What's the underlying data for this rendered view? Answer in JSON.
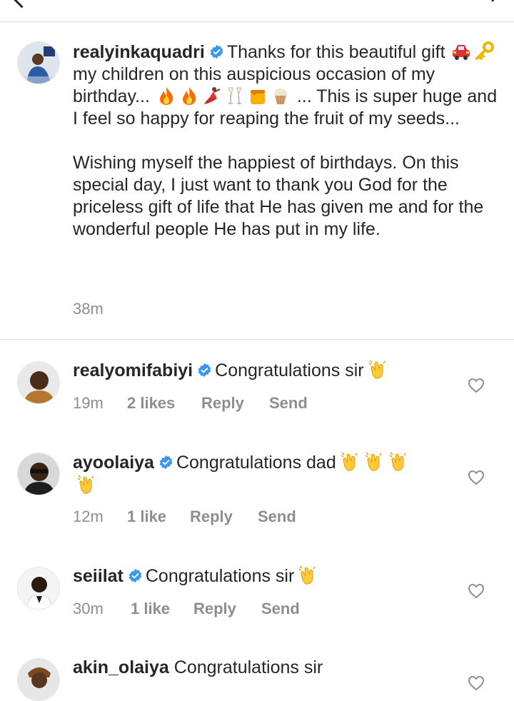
{
  "post": {
    "username": "realyinkaquadri",
    "caption_p1_a": "Thanks for this beautiful gift",
    "caption_p1_b": "my children on this auspicious occasion of my birthday...",
    "caption_p1_c": "... This is super huge and I feel so happy for reaping the fruit of my seeds...",
    "caption_p2": "Wishing myself the happiest of birthdays. On this special day, I just want to thank you God for the priceless gift of life that He has given me and for the wonderful people He has put in my life.",
    "time": "38m"
  },
  "comments": [
    {
      "username": "realyomifabiyi",
      "text": "Congratulations sir",
      "time": "19m",
      "likes": "2 likes",
      "reply": "Reply",
      "send": "Send"
    },
    {
      "username": "ayoolaiya",
      "text": "Congratulations dad",
      "time": "12m",
      "likes": "1 like",
      "reply": "Reply",
      "send": "Send"
    },
    {
      "username": "seiilat",
      "text": "Congratulations sir",
      "time": "30m",
      "likes": "1 like",
      "reply": "Reply",
      "send": "Send"
    },
    {
      "username": "akin_olaiya",
      "text": "Congratulations sir"
    }
  ],
  "icons": {
    "verified": "verified-badge-icon",
    "heart": "heart-outline-icon",
    "clap": "clapping-hands-emoji",
    "car": "car-emoji",
    "key": "key-emoji",
    "fire": "fire-emoji",
    "dancer": "dancer-emoji",
    "glasses": "champagne-glasses-emoji",
    "honey": "honey-pot-emoji",
    "cupcake": "cupcake-emoji"
  },
  "colors": {
    "verified": "#3897f0",
    "muted": "#8e8e8e",
    "text": "#262626",
    "divider": "#dbdbdb"
  }
}
